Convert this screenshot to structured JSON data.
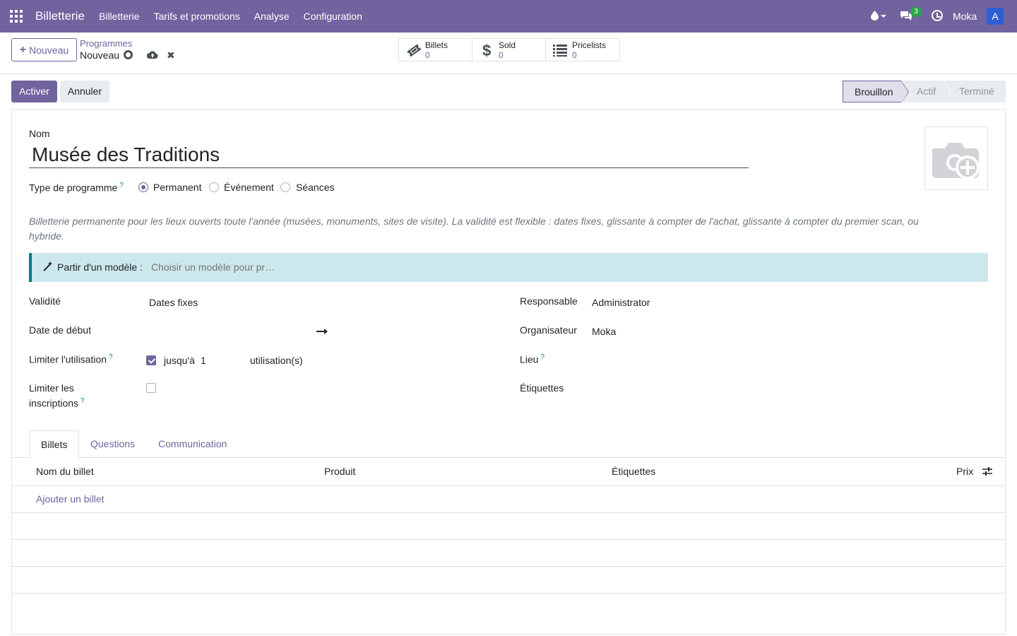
{
  "navbar": {
    "brand": "Billetterie",
    "menu": [
      "Billetterie",
      "Tarifs et promotions",
      "Analyse",
      "Configuration"
    ],
    "chat_badge": "3",
    "company": "Moka",
    "avatar_letter": "A"
  },
  "control": {
    "new_label": "Nouveau",
    "breadcrumb": "Programmes",
    "record_name": "Nouveau",
    "smart_buttons": [
      {
        "label": "Billets",
        "value": "0",
        "icon": "ticket-icon"
      },
      {
        "label": "Sold",
        "value": "0",
        "icon": "dollar-icon"
      },
      {
        "label": "Pricelists",
        "value": "0",
        "icon": "list-icon"
      }
    ]
  },
  "actions": {
    "activate": "Activer",
    "cancel": "Annuler"
  },
  "status": {
    "stages": [
      "Brouillon",
      "Actif",
      "Terminé"
    ],
    "current": "Brouillon"
  },
  "form": {
    "name_label": "Nom",
    "name_value": "Musée des Traditions",
    "type_label": "Type de programme",
    "help_mark": "?",
    "types": [
      {
        "label": "Permanent",
        "checked": true
      },
      {
        "label": "Événement",
        "checked": false
      },
      {
        "label": "Séances",
        "checked": false
      }
    ],
    "description": "Billetterie permanente pour les lieux ouverts toute l'année (musées, monuments, sites de visite). La validité est flexible : dates fixes, glissante à compter de l'achat, glissante à compter du premier scan, ou hybride.",
    "template_label": "Partir d'un modèle :",
    "template_placeholder": "Choisir un modèle pour pr…",
    "validity_label": "Validité",
    "validity_value": "Dates fixes",
    "start_date_label": "Date de début",
    "limit_usage_label": "Limiter l'utilisation",
    "limit_usage_checked": true,
    "limit_usage_prefix": "jusqu'à",
    "limit_usage_count": "1",
    "limit_usage_suffix": "utilisation(s)",
    "limit_reg_label_1": "Limiter les",
    "limit_reg_label_2": "inscriptions",
    "limit_reg_checked": false,
    "responsible_label": "Responsable",
    "responsible_value": "Administrator",
    "organizer_label": "Organisateur",
    "organizer_value": "Moka",
    "venue_label": "Lieu",
    "tags_label": "Étiquettes"
  },
  "tabs": {
    "items": [
      "Billets",
      "Questions",
      "Communication"
    ],
    "active": "Billets"
  },
  "list": {
    "columns": [
      "Nom du billet",
      "Produit",
      "Étiquettes",
      "Prix"
    ],
    "add_line": "Ajouter un billet"
  },
  "colors": {
    "primary": "#71639e",
    "info_bg": "#cde8ec",
    "badge": "#28a745",
    "avatar": "#2d5fd3"
  }
}
